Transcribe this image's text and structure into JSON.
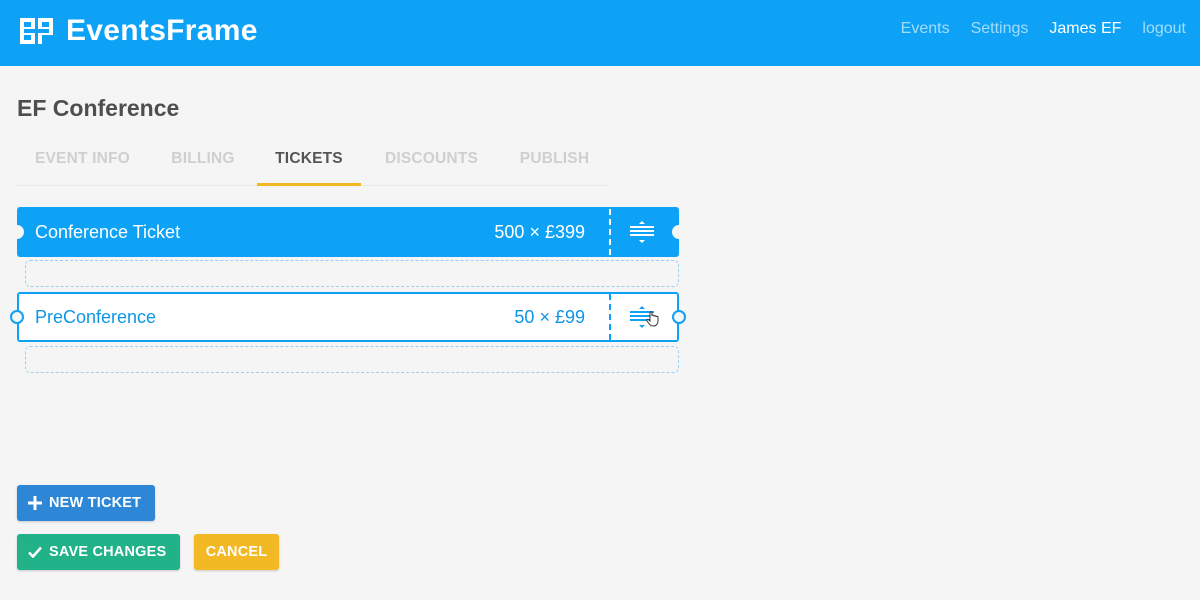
{
  "header": {
    "brand": "EventsFrame",
    "nav": [
      {
        "label": "Events",
        "active": false
      },
      {
        "label": "Settings",
        "active": false
      },
      {
        "label": "James EF",
        "active": true
      },
      {
        "label": "logout",
        "active": false
      }
    ]
  },
  "event": {
    "title": "EF Conference"
  },
  "tabs": [
    {
      "label": "EVENT INFO",
      "active": false
    },
    {
      "label": "BILLING",
      "active": false
    },
    {
      "label": "TICKETS",
      "active": true
    },
    {
      "label": "DISCOUNTS",
      "active": false
    },
    {
      "label": "PUBLISH",
      "active": false
    }
  ],
  "tickets": [
    {
      "name": "Conference Ticket",
      "quantity": "500 × £399",
      "style": "selected"
    },
    {
      "name": "PreConference",
      "quantity": "50 × £99",
      "style": "dragging"
    }
  ],
  "actions": {
    "new_ticket": "NEW TICKET",
    "save": "SAVE CHANGES",
    "cancel": "CANCEL"
  },
  "colors": {
    "brand_blue": "#0da2f5",
    "tab_underline": "#f2b824",
    "new_ticket_button": "#2d87d6",
    "save_button": "#22b28a",
    "cancel_button": "#f2b924"
  },
  "icons": {
    "brand": "eventsframe-logo-icon",
    "drag_handle": "drag-handle-icon",
    "new_ticket": "plus-icon",
    "save": "checkmark-icon",
    "cursor": "hand-cursor-icon"
  }
}
